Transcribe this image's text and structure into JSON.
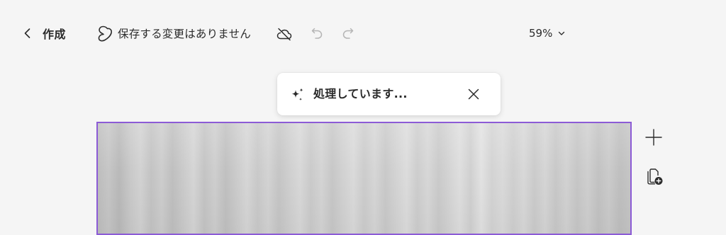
{
  "toolbar": {
    "back": {
      "label": "作成",
      "icon": "chevron-left-icon"
    },
    "save_status": {
      "text": "保存する変更はありません",
      "icon": "app-logo-icon"
    },
    "cloud_icon": "cloud-off-icon",
    "undo_icon": "undo-icon",
    "redo_icon": "redo-icon",
    "zoom": {
      "value": "59%",
      "icon": "chevron-down-icon"
    }
  },
  "toast": {
    "text": "処理しています...",
    "icon": "sparkle-icon",
    "close_icon": "close-icon"
  },
  "side_tools": {
    "add_icon": "plus-icon",
    "add_page_icon": "add-page-icon"
  },
  "colors": {
    "background": "#f5f5f5",
    "selection_border": "#8c5bd6",
    "text": "#2b2b2b",
    "disabled_icon": "#b5b5b5",
    "toast_background": "#ffffff"
  }
}
